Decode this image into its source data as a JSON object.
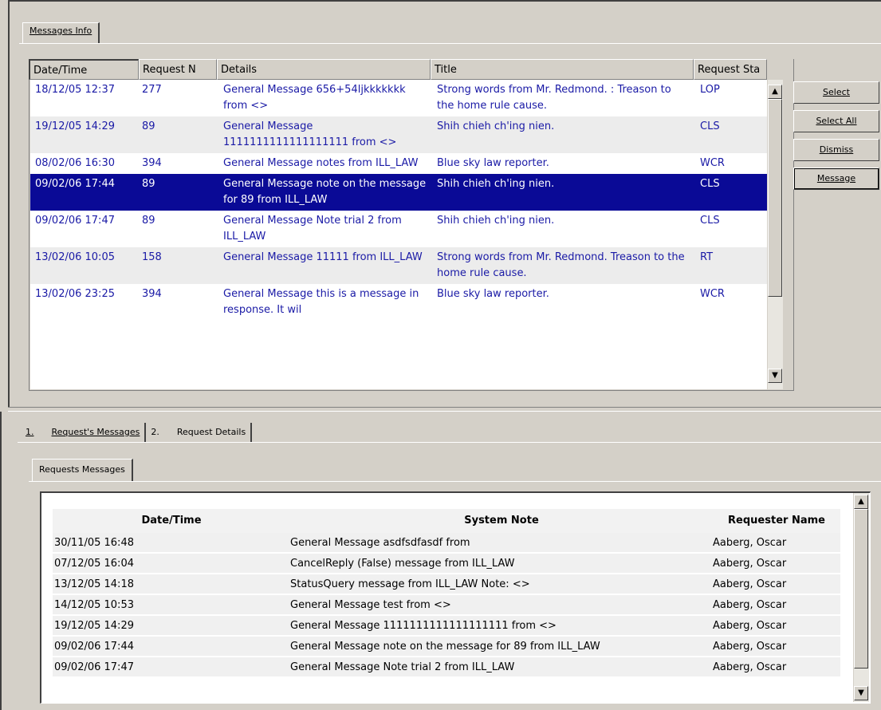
{
  "top_tab": "Messages Info",
  "grid": {
    "columns": [
      "Date/Time",
      "Request N",
      "Details",
      "Title",
      "Request Sta"
    ],
    "rows": [
      {
        "date": "18/12/05 12:37",
        "req": "277",
        "details": "General Message 656+54ljkkkkkkk from <>",
        "title": "Strong words from Mr. Redmond. : Treason to the home rule cause.",
        "status": "LOP"
      },
      {
        "date": "19/12/05 14:29",
        "req": "89",
        "details": "General Message 1111111111111111111 from <>",
        "title": "Shih chieh ch'ing nien.",
        "status": "CLS"
      },
      {
        "date": "08/02/06 16:30",
        "req": "394",
        "details": "General Message notes from ILL_LAW",
        "title": "Blue sky law reporter.",
        "status": "WCR"
      },
      {
        "date": "09/02/06 17:44",
        "req": "89",
        "details": "General Message note on the message for 89 from ILL_LAW",
        "title": "Shih chieh ch'ing nien.",
        "status": "CLS"
      },
      {
        "date": "09/02/06 17:47",
        "req": "89",
        "details": "General Message Note trial 2 from ILL_LAW",
        "title": "Shih chieh ch'ing nien.",
        "status": "CLS"
      },
      {
        "date": "13/02/06 10:05",
        "req": "158",
        "details": "General Message 11111 from ILL_LAW",
        "title": "Strong words from Mr. Redmond. Treason to the home rule cause.",
        "status": "RT"
      },
      {
        "date": "13/02/06 23:25",
        "req": "394",
        "details": "General Message this is a message in response. It wil",
        "title": "Blue sky law reporter.",
        "status": "WCR"
      }
    ],
    "selected_index": 3
  },
  "side_buttons": {
    "select": "Select",
    "select_all": "Select All",
    "dismiss": "Dismiss",
    "message": "Message"
  },
  "lower_tabs": [
    {
      "num": "1.",
      "label": "Request's Messages"
    },
    {
      "num": "2.",
      "label": "Request Details"
    }
  ],
  "inner_tab": "Requests Messages",
  "messages": {
    "columns": [
      "Date/Time",
      "System Note",
      "Requester Name"
    ],
    "rows": [
      {
        "date": "30/11/05 16:48",
        "note": "General Message asdfsdfasdf from",
        "name": "Aaberg, Oscar"
      },
      {
        "date": "07/12/05 16:04",
        "note": "CancelReply (False) message from ILL_LAW",
        "name": "Aaberg, Oscar"
      },
      {
        "date": "13/12/05 14:18",
        "note": "StatusQuery message from ILL_LAW Note: <>",
        "name": "Aaberg, Oscar"
      },
      {
        "date": "14/12/05 10:53",
        "note": "General Message test from <>",
        "name": "Aaberg, Oscar"
      },
      {
        "date": "19/12/05 14:29",
        "note": "General Message 1111111111111111111 from <>",
        "name": "Aaberg, Oscar"
      },
      {
        "date": "09/02/06 17:44",
        "note": "General Message note on the message for 89 from ILL_LAW",
        "name": "Aaberg, Oscar"
      },
      {
        "date": "09/02/06 17:47",
        "note": "General Message Note trial 2 from ILL_LAW",
        "name": "Aaberg, Oscar"
      }
    ]
  },
  "icons": {
    "scroll_up": "up-arrow-icon",
    "scroll_down": "down-arrow-icon"
  }
}
